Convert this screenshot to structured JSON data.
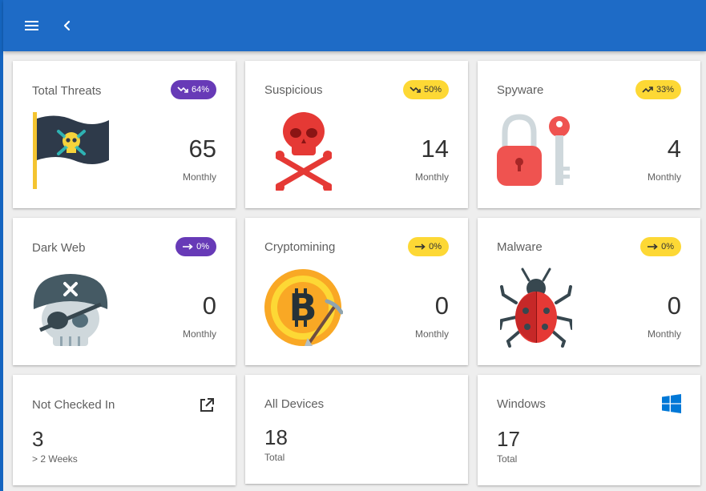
{
  "appbar": {
    "menu_icon": "menu-icon",
    "back_icon": "chevron-left-icon"
  },
  "cards": [
    {
      "title": "Total Threats",
      "badge": "64%",
      "trend": "trending-down",
      "badge_color": "#673ab7",
      "value": "65",
      "unit": "Monthly",
      "icon": "pirate-flag-icon"
    },
    {
      "title": "Suspicious",
      "badge": "50%",
      "trend": "trending-down",
      "badge_color": "#fdd835",
      "value": "14",
      "unit": "Monthly",
      "icon": "skull-crossbones-icon"
    },
    {
      "title": "Spyware",
      "badge": "33%",
      "trend": "trending-up",
      "badge_color": "#fdd835",
      "value": "4",
      "unit": "Monthly",
      "icon": "lock-key-icon"
    },
    {
      "title": "Dark Web",
      "badge": "0%",
      "trend": "trending-flat",
      "badge_color": "#673ab7",
      "value": "0",
      "unit": "Monthly",
      "icon": "pirate-skull-icon"
    },
    {
      "title": "Cryptomining",
      "badge": "0%",
      "trend": "trending-flat",
      "badge_color": "#fdd835",
      "value": "0",
      "unit": "Monthly",
      "icon": "bitcoin-pickaxe-icon"
    },
    {
      "title": "Malware",
      "badge": "0%",
      "trend": "trending-flat",
      "badge_color": "#fdd835",
      "value": "0",
      "unit": "Monthly",
      "icon": "bug-icon"
    }
  ],
  "stats": [
    {
      "title": "Not Checked In",
      "value": "3",
      "sub": "> 2 Weeks",
      "icon": "open-in-new-icon"
    },
    {
      "title": "All Devices",
      "value": "18",
      "sub": "Total"
    },
    {
      "title": "Windows",
      "value": "17",
      "sub": "Total",
      "icon": "windows-logo-icon"
    }
  ],
  "colors": {
    "appbar": "#1e6bc6",
    "badge_purple": "#673ab7",
    "badge_yellow": "#fdd835",
    "windows_blue": "#0078d7"
  }
}
